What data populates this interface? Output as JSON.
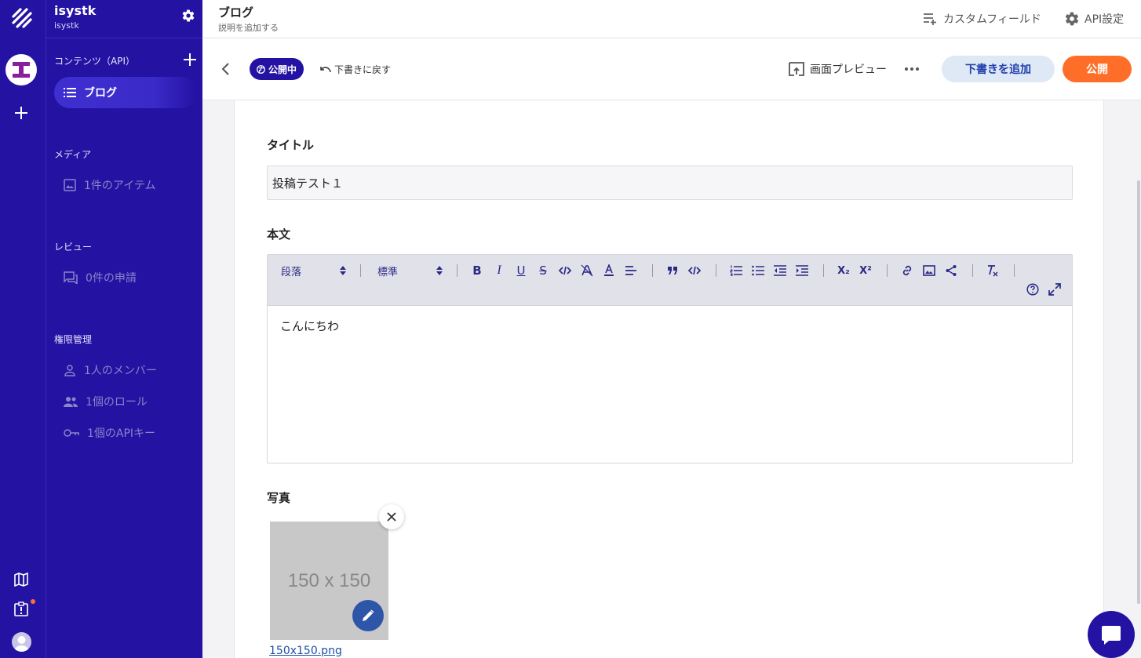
{
  "service": {
    "name": "isystk",
    "id": "isystk"
  },
  "sidebar": {
    "content_section": "コンテンツ（API）",
    "active_item": "ブログ",
    "media_section": "メディア",
    "media_item": "1件のアイテム",
    "review_section": "レビュー",
    "review_item": "0件の申請",
    "permission_section": "権限管理",
    "member_item": "1人のメンバー",
    "role_item": "1個のロール",
    "apikey_item": "1個のAPIキー"
  },
  "header": {
    "title": "ブログ",
    "subtitle": "説明を追加する",
    "custom_field": "カスタムフィールド",
    "api_settings": "API設定"
  },
  "actions": {
    "status": "公開中",
    "revert": "下書きに戻す",
    "preview": "画面プレビュー",
    "draft_button": "下書きを追加",
    "publish_button": "公開"
  },
  "form": {
    "title_label": "タイトル",
    "title_value": "投稿テスト１",
    "body_label": "本文",
    "body_text": "こんにちわ",
    "photo_label": "写真",
    "photo_placeholder": "150 x 150",
    "photo_filename": "150x150.png"
  },
  "toolbar": {
    "format_select": "段落",
    "size_select": "標準",
    "bold": "B",
    "italic": "I",
    "underline": "U",
    "strike": "S",
    "subscript": "X₂",
    "superscript": "X²"
  },
  "colors": {
    "brand": "#2412a3",
    "publish": "#ff6e29",
    "draft_bg": "#dfe8f5"
  }
}
